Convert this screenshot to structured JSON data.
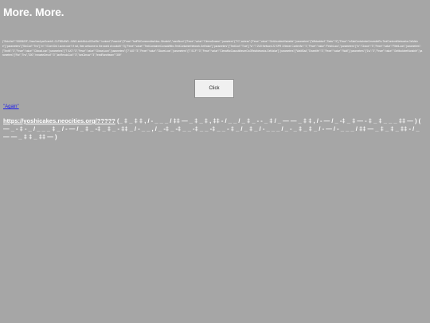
{
  "page": {
    "title": "More. More."
  },
  "json_dump": "{\"StdoVerf\":\"0083622F, Grwu!\\nw1pwOcenb5..CLPBDAWS..JUND-lobbNhLz4G2a09o\":\"content\",PoweLid\":[\"Fewe\":\"fsdRNCommmdbsrNwc..Wsmbtd\",\"candNum\":[\"Fewe\",\"value\":\"CleeraDoame\",\"pameters\":[\"TC\",achess\":[\"Fewe\",\"value\":\"GetLfooldeetVariable\",\"parameters\":[\"Witdaddset\",\"Sabs\":\"3\"],\"Fewe\":\"\\nSabContwimbeCmwwbbRu-TeofContemtNetwoeks.GetValue\"],\"parameters\":[\"StcCod\":\"Trw\"],\"\\n\":\"I Dont D/d I acnm use? If not, then welcome to the world of ccutoth\":\"3},\"Fewe\":\"value\":\"TextContainerCoxwaWithc.TextContainerNetwork.GetValue\"],\"parameters\":[\"TextCod\":\"True\"],\"\\n\":\"7 2U0 Network 22 SPR 1Viewer Content\\n\":\"1\",\"Fewe\":\"value\":\"FetchLooo\",\"parameters\":[\"\\n\":\"Clwow\":\"3\",\"Fewe\":\"value\":\"FittelLoon\",\"parameters\":[\"TextN\":\"3\",\"Fewe\":\"value\":\"ClkwwLoon\",\"parameters\":[\"7 \\UG\":\"3\",\"Fewe\":\"value\":\"GloweLoon\",\"parameters\":[\"7 \\UG\":\"3\",\"Fewe\":\"value\":\"GloweLoon\",\"parameters\":[\"7 SCF\":\"3\",\"Fewe\":\"value\":\"CleewBwCasusbilteureCw3RelaNetwoks.GetValue\"],\"parameters\":[\"WaitlSad\",\"Dweelife\":\"3\",\"Fewe\":\"value\":\"Walt\"],\"parameters\":[\"1\\u\":\"3\",\"Fewe\":\"value\":\"GetlfooldeetVariable\",\"parameters\":[\"Fiw\",\"Trw\",\"300\",\"nmaeteDesrd\":\"3\",\"ianRendoCod\":\"3\",\"ianClmow\":\"3\",\"leedRoneIteam\":\"309\"",
  "button": {
    "label": "Click"
  },
  "again_link": {
    "label": "Again"
  },
  "url_line": {
    "url": "https://yoshicakes.neocities.org/?????",
    "glyph_text": " (_ ‡ _ ‡ ‡ , / -  _ _ _ / ‡‡ — _ ‡ _ ‡ , ‡‡ - / _ _ / _ ‡ _ - - _ ‡ / _ — — _ ‡ ‡ , / - — / _ -‡ _ ‡ — - ‡ _ ‡ _ _ _ ‡‡ — ) ( — _ - ‡ - _ / _ _ _ ‡ _ / - — / _ ‡ _ -‡ _ ‡ _ - ‡‡ _ / - _ _ , / _ -‡ _ -‡ _ _ -‡ _ _ -‡ _ _ - ‡ _ / _ ‡ _ / - _ _ _ / _ - _ ‡ _ ‡ _ / - — / - _ _ _ / ‡‡ — _ ‡ _ ‡ _ ‡‡ - / _ — — _ ‡ ‡ _ ‡‡ — )"
  }
}
